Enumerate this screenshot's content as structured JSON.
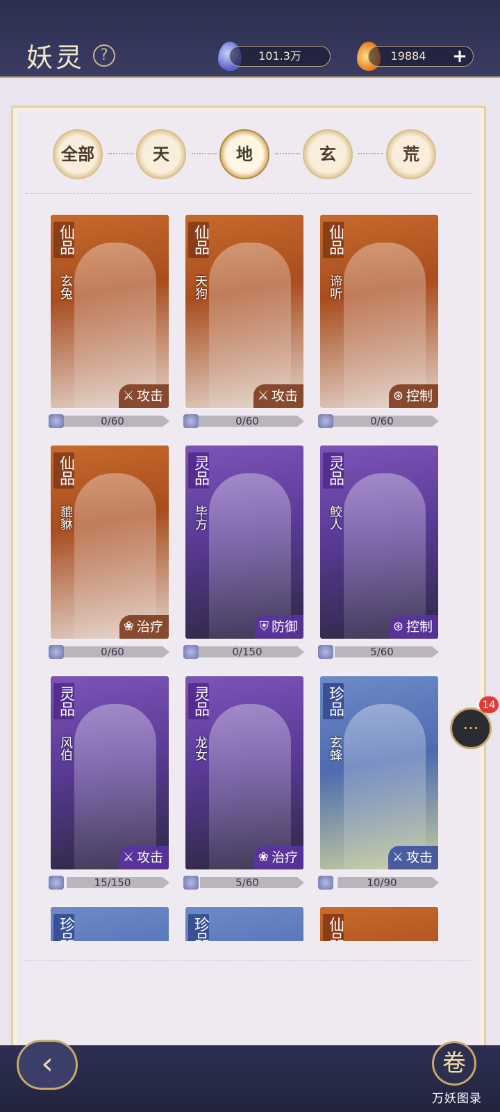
{
  "header": {
    "title": "妖灵",
    "help_icon": "?",
    "jade_amount": "101.3万",
    "fire_amount": "19884",
    "plus_label": "+"
  },
  "tabs": [
    {
      "label": "全部"
    },
    {
      "label": "天"
    },
    {
      "label": "地",
      "active": true
    },
    {
      "label": "玄"
    },
    {
      "label": "荒"
    }
  ],
  "cards": [
    {
      "grade": "仙品",
      "name": "玄兔",
      "role": "攻击",
      "role_icon": "⚔",
      "progress": "0/60",
      "fraction": 0
    },
    {
      "grade": "仙品",
      "name": "天狗",
      "role": "攻击",
      "role_icon": "⚔",
      "progress": "0/60",
      "fraction": 0
    },
    {
      "grade": "仙品",
      "name": "谛听",
      "role": "控制",
      "role_icon": "⊛",
      "progress": "0/60",
      "fraction": 0
    },
    {
      "grade": "仙品",
      "name": "貔貅",
      "role": "治疗",
      "role_icon": "❀",
      "progress": "0/60",
      "fraction": 0
    },
    {
      "grade": "灵品",
      "name": "毕方",
      "role": "防御",
      "role_icon": "⛨",
      "progress": "0/150",
      "fraction": 0
    },
    {
      "grade": "灵品",
      "name": "鲛人",
      "role": "控制",
      "role_icon": "⊛",
      "progress": "5/60",
      "fraction": 0.083
    },
    {
      "grade": "灵品",
      "name": "风伯",
      "role": "攻击",
      "role_icon": "⚔",
      "progress": "15/150",
      "fraction": 0.1
    },
    {
      "grade": "灵品",
      "name": "龙女",
      "role": "治疗",
      "role_icon": "❀",
      "progress": "5/60",
      "fraction": 0.083
    },
    {
      "grade": "珍品",
      "name": "玄蜂",
      "role": "攻击",
      "role_icon": "⚔",
      "progress": "10/90",
      "fraction": 0.111
    },
    {
      "grade": "珍品"
    },
    {
      "grade": "珍品"
    },
    {
      "grade": "仙品"
    }
  ],
  "bottom": {
    "back_icon": "‹",
    "codex_icon": "卷",
    "codex_label": "万妖图录"
  },
  "chat": {
    "icon": "···",
    "badge": "14"
  }
}
